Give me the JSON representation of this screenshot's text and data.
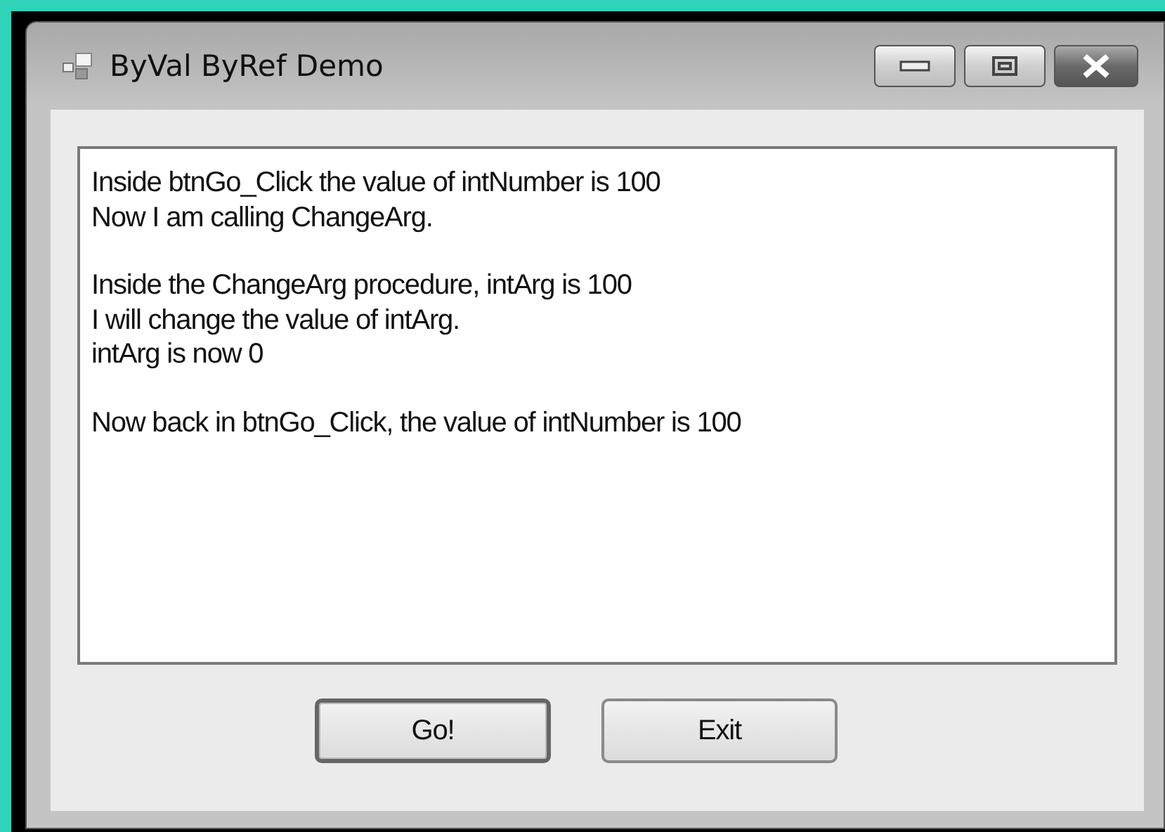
{
  "window": {
    "title": "ByVal ByRef Demo"
  },
  "output": {
    "paragraphs": [
      [
        "Inside btnGo_Click the value of intNumber is 100",
        "Now I am calling ChangeArg."
      ],
      [
        "Inside the ChangeArg procedure, intArg is 100",
        "I will change the value of intArg.",
        "intArg is now 0"
      ],
      [
        "Now back in btnGo_Click, the value of intNumber is 100"
      ]
    ]
  },
  "buttons": [
    {
      "label": "Go!",
      "default": true
    },
    {
      "label": "Exit",
      "default": false
    }
  ]
}
